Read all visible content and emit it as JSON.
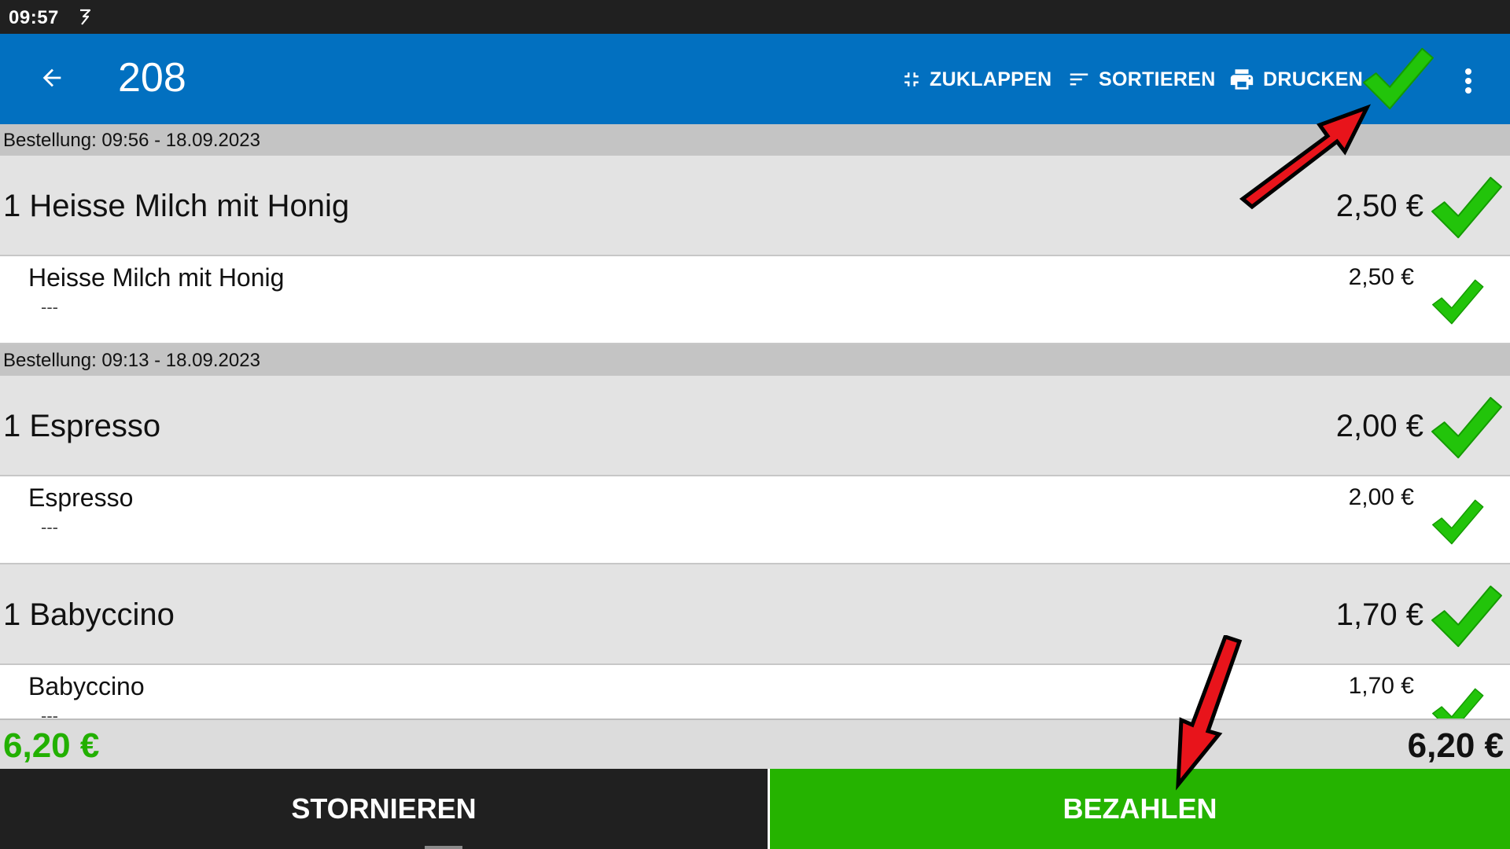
{
  "status_bar": {
    "time": "09:57"
  },
  "toolbar": {
    "title": "208",
    "collapse_label": "ZUKLAPPEN",
    "sort_label": "SORTIEREN",
    "print_label": "DRUCKEN"
  },
  "orders": [
    {
      "header": "Bestellung: 09:56 - 18.09.2023",
      "items": [
        {
          "name": "1 Heisse Milch mit Honig",
          "price": "2,50 €",
          "sub": {
            "name": "Heisse Milch mit Honig",
            "note": "---",
            "price": "2,50 €"
          }
        }
      ]
    },
    {
      "header": "Bestellung: 09:13 - 18.09.2023",
      "items": [
        {
          "name": "1 Espresso",
          "price": "2,00 €",
          "sub": {
            "name": "Espresso",
            "note": "---",
            "price": "2,00 €"
          }
        },
        {
          "name": "1 Babyccino",
          "price": "1,70 €",
          "sub": {
            "name": "Babyccino",
            "note": "---",
            "price": "1,70 €"
          }
        }
      ]
    }
  ],
  "totals": {
    "selected": "6,20 €",
    "total": "6,20 €"
  },
  "buttons": {
    "cancel": "STORNIEREN",
    "pay": "BEZAHLEN"
  },
  "colors": {
    "toolbar": "#0270c0",
    "check_green": "#22c40a",
    "pay_green": "#25b300",
    "total_green": "#22b000",
    "arrow_red": "#e8141b"
  },
  "icons": [
    "back-arrow-icon",
    "collapse-icon",
    "sort-icon",
    "printer-icon",
    "checkmark-icon",
    "more-vert-icon"
  ]
}
